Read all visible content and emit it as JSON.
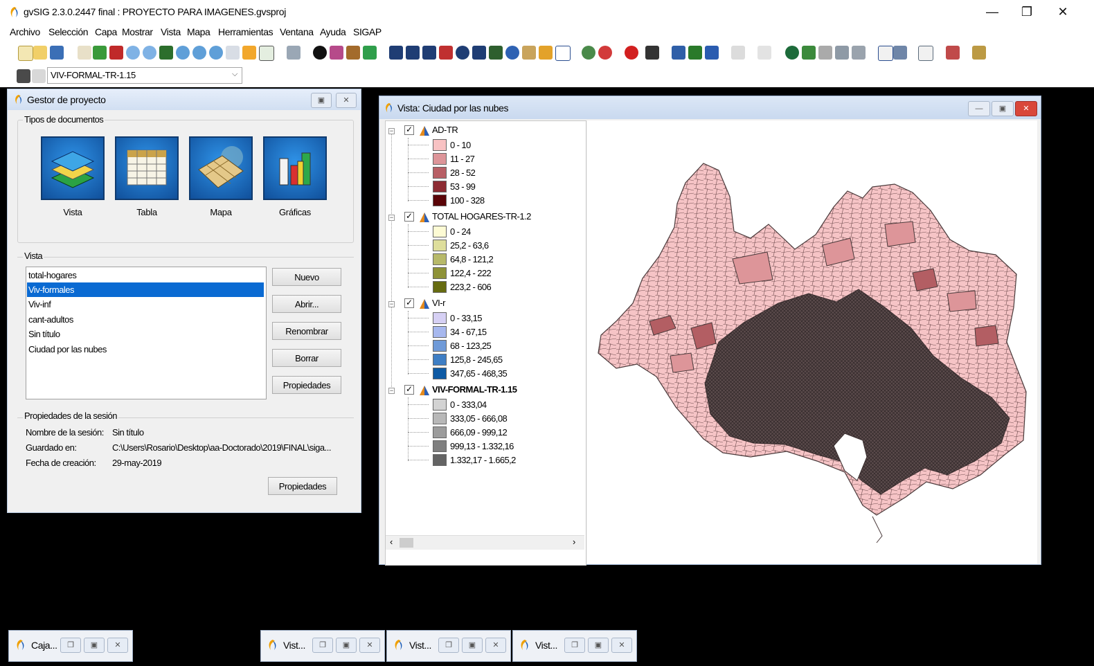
{
  "app": {
    "title": "gvSIG 2.3.0.2447 final : PROYECTO PARA IMAGENES.gvsproj",
    "win_min": "—",
    "win_max": "❐",
    "win_close": "✕"
  },
  "menu": [
    "Archivo",
    "Selección",
    "Capa",
    "Mostrar",
    "Vista",
    "Mapa",
    "Herramientas",
    "Ventana",
    "Ayuda",
    "SIGAP"
  ],
  "layer_select": {
    "value": "VIV-FORMAL-TR-1.15"
  },
  "project_manager": {
    "title": "Gestor de proyecto",
    "doc_types_label": "Tipos de documentos",
    "doc_types": [
      "Vista",
      "Tabla",
      "Mapa",
      "Gráficas"
    ],
    "view_section_label": "Vista",
    "views": [
      "total-hogares",
      "Viv-formales",
      "Viv-inf",
      "cant-adultos",
      "Sin título",
      "Ciudad por las nubes"
    ],
    "selected_view": "Viv-formales",
    "buttons": [
      "Nuevo",
      "Abrir...",
      "Renombrar",
      "Borrar",
      "Propiedades"
    ],
    "session": {
      "section_label": "Propiedades de la sesión",
      "name_label": "Nombre de la sesión:",
      "name_value": "Sin título",
      "saved_label": "Guardado en:",
      "saved_value": "C:\\Users\\Rosario\\Desktop\\aa-Doctorado\\2019\\FINAL\\siga...",
      "date_label": "Fecha de creación:",
      "date_value": "29-may-2019",
      "properties_button": "Propiedades"
    }
  },
  "view_window": {
    "title": "Vista: Ciudad por las nubes",
    "layers": [
      {
        "name": "AD-TR",
        "checked": true,
        "legend": [
          {
            "label": "0 - 10",
            "color": "#f8c2c3"
          },
          {
            "label": "11 - 27",
            "color": "#dd9599"
          },
          {
            "label": "28 - 52",
            "color": "#b85f65"
          },
          {
            "label": "53 - 99",
            "color": "#8d2c33"
          },
          {
            "label": "100 - 328",
            "color": "#5a0508"
          }
        ]
      },
      {
        "name": "TOTAL HOGARES-TR-1.2",
        "checked": true,
        "legend": [
          {
            "label": "0 - 24",
            "color": "#fdfbd4"
          },
          {
            "label": "25,2 - 63,6",
            "color": "#dede9c"
          },
          {
            "label": "64,8 - 121,2",
            "color": "#b7b96a"
          },
          {
            "label": "122,4 - 222",
            "color": "#8e9238"
          },
          {
            "label": "223,2 - 606",
            "color": "#666b10"
          }
        ]
      },
      {
        "name": "VI-r",
        "checked": true,
        "legend": [
          {
            "label": "0 - 33,15",
            "color": "#d6d0f4"
          },
          {
            "label": "34 - 67,15",
            "color": "#a7b8ee"
          },
          {
            "label": "68 - 123,25",
            "color": "#6f9ad8"
          },
          {
            "label": "125,8 - 245,65",
            "color": "#3e7ec4"
          },
          {
            "label": "347,65 - 468,35",
            "color": "#0e5aa4"
          }
        ]
      },
      {
        "name": "VIV-FORMAL-TR-1.15",
        "checked": true,
        "bold": true,
        "legend": [
          {
            "label": "0 - 333,04",
            "color": "#d3d3d3"
          },
          {
            "label": "333,05 - 666,08",
            "color": "#b8b8b8"
          },
          {
            "label": "666,09 - 999,12",
            "color": "#9c9c9c"
          },
          {
            "label": "999,13 - 1.332,16",
            "color": "#7f7f7f"
          },
          {
            "label": "1.332,17 - 1.665,2",
            "color": "#646464"
          }
        ]
      }
    ]
  },
  "taskbar": [
    "Caja...",
    "Vist...",
    "Vist...",
    "Vist..."
  ],
  "colors": {
    "selection": "#0a6ad2",
    "map_fill_light": "#f6c4c6",
    "map_edge": "#4a3a3b"
  }
}
